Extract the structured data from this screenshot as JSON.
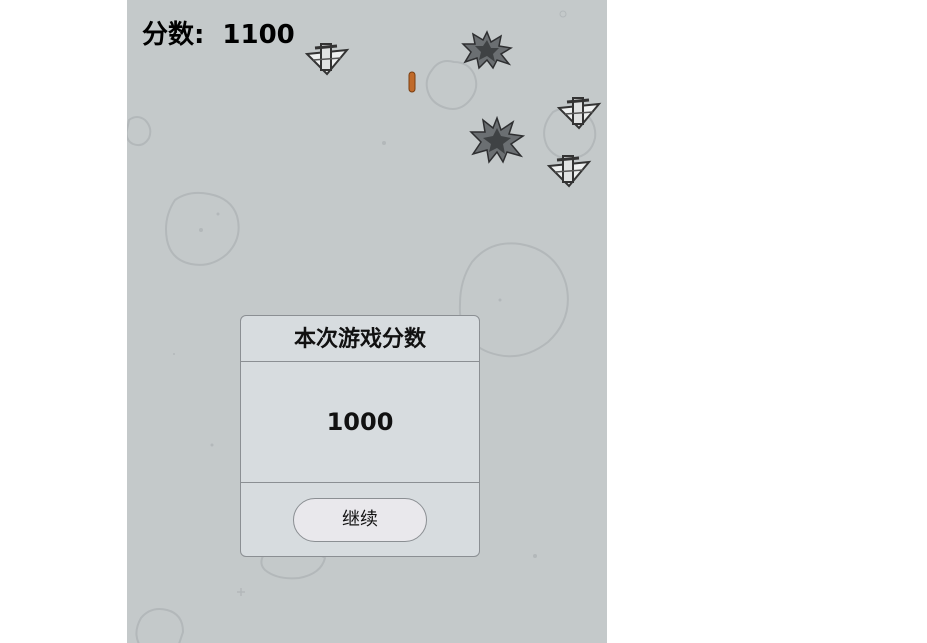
{
  "hud": {
    "score_label": "分数:",
    "score_value": "1100"
  },
  "dialog": {
    "title": "本次游戏分数",
    "score": "1000",
    "continue_label": "继续"
  },
  "sprites": {
    "plane_icon": "enemy-plane",
    "explosion_icon": "explosion",
    "bullet_icon": "bullet"
  },
  "colors": {
    "background": "#c4c9ca",
    "dialog_bg": "#d7dcdf",
    "button_bg": "#e9e8ec",
    "bullet": "#c06a2a"
  }
}
